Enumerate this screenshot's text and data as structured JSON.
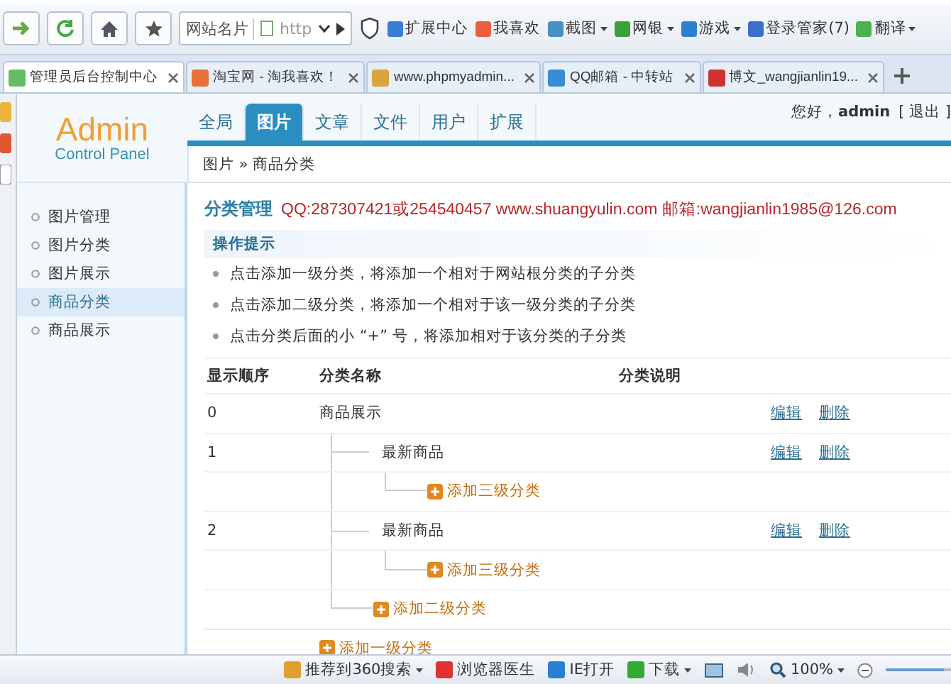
{
  "toolbar": {
    "address_label": "网站名片",
    "address_value": "http",
    "extensions": [
      {
        "label": "扩展中心",
        "dropdown": false
      },
      {
        "label": "我喜欢",
        "dropdown": false
      },
      {
        "label": "截图",
        "dropdown": true
      },
      {
        "label": "网银",
        "dropdown": true
      },
      {
        "label": "游戏",
        "dropdown": true
      },
      {
        "label": "登录管家(7)",
        "dropdown": false
      },
      {
        "label": "翻译",
        "dropdown": true
      }
    ]
  },
  "browser_tabs": [
    {
      "title": "管理员后台控制中心",
      "selected": true
    },
    {
      "title": "淘宝网 - 淘我喜欢！",
      "selected": false
    },
    {
      "title": "www.phpmyadmin...",
      "selected": false
    },
    {
      "title": "QQ邮箱 - 中转站",
      "selected": false
    },
    {
      "title": "博文_wangjianlin19...",
      "selected": false
    }
  ],
  "page": {
    "logo_title": "Admin",
    "logo_subtitle": "Control Panel",
    "nav": [
      {
        "label": "全局",
        "selected": false
      },
      {
        "label": "图片",
        "selected": true
      },
      {
        "label": "文章",
        "selected": false
      },
      {
        "label": "文件",
        "selected": false
      },
      {
        "label": "用户",
        "selected": false
      },
      {
        "label": "扩展",
        "selected": false
      }
    ],
    "greeting": "您好，**admin**",
    "logout": "[ 退出 ]",
    "breadcrumb": "图片 » 商品分类",
    "sidebar": [
      {
        "label": "图片管理",
        "selected": false
      },
      {
        "label": "图片分类",
        "selected": false
      },
      {
        "label": "图片展示",
        "selected": false
      },
      {
        "label": "商品分类",
        "selected": true
      },
      {
        "label": "商品展示",
        "selected": false
      }
    ],
    "heading": "分类管理",
    "contact": "QQ:287307421或254540457 www.shuangyulin.com 邮箱:wangjianlin1985@126.com",
    "tips_title": "操作提示",
    "tips": [
      "点击添加一级分类，将添加一个相对于网站根分类的子分类",
      "点击添加二级分类，将添加一个相对于该一级分类的子分类",
      "点击分类后面的小 “+” 号，将添加相对于该分类的子分类"
    ],
    "table": {
      "columns": [
        "显示顺序",
        "分类名称",
        "分类说明"
      ],
      "categories": [
        {
          "order": "0",
          "name": "商品展示",
          "edit": "编辑",
          "delete": "删除",
          "add_link": "添加二级分类",
          "children": [
            {
              "order": "1",
              "name": "最新商品",
              "edit": "编辑",
              "delete": "删除",
              "add_link": "添加三级分类"
            },
            {
              "order": "2",
              "name": "最新商品",
              "edit": "编辑",
              "delete": "删除",
              "add_link": "添加三级分类"
            }
          ]
        }
      ],
      "add_link": "添加一级分类"
    }
  },
  "status_bar": {
    "items": [
      {
        "label": "推荐到360搜索",
        "dropdown": true
      },
      {
        "label": "浏览器医生",
        "dropdown": false
      },
      {
        "label": "IE打开",
        "dropdown": false
      },
      {
        "label": "下载",
        "dropdown": true
      }
    ],
    "zoom": "100%",
    "zoom_slider": {
      "level": 0.9
    }
  }
}
